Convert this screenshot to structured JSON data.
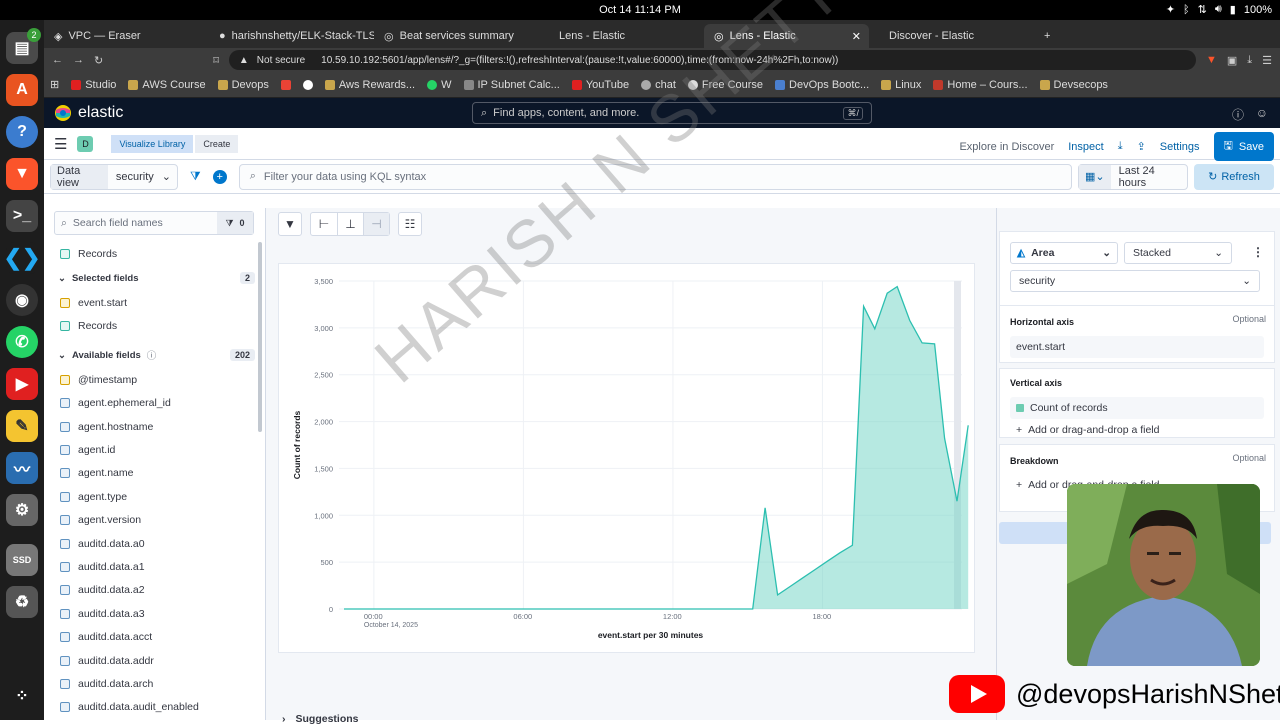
{
  "os": {
    "clock": "Oct 14  11:14 PM",
    "battery": "100%",
    "dock_badge": "2"
  },
  "browser": {
    "tabs": [
      {
        "label": "VPC — Eraser",
        "active": false
      },
      {
        "label": "harishnshetty/ELK-Stack-TLS",
        "active": false
      },
      {
        "label": "Beat services summary",
        "active": false
      },
      {
        "label": "Lens - Elastic",
        "active": false
      },
      {
        "label": "Lens - Elastic",
        "active": true
      },
      {
        "label": "Discover - Elastic",
        "active": false
      }
    ],
    "not_secure": "Not secure",
    "url": "10.59.10.192:5601/app/lens#/?_g=(filters:!(),refreshInterval:(pause:!t,value:60000),time:(from:now-24h%2Fh,to:now))",
    "bookmarks": [
      "Studio",
      "AWS Course",
      "Devops",
      "Aws Rewards...",
      "W",
      "IP Subnet Calc...",
      "YouTube",
      "chat",
      "Free Course",
      "DevOps Bootc...",
      "Linux",
      "Home – Cours...",
      "Devsecops"
    ]
  },
  "kibana": {
    "brand": "elastic",
    "search_placeholder": "Find apps, content, and more.",
    "search_shortcut": "⌘/",
    "space_letter": "D",
    "breadcrumbs": [
      "Visualize Library",
      "Create"
    ],
    "actions": {
      "explore": "Explore in Discover",
      "inspect": "Inspect",
      "settings": "Settings",
      "save": "Save"
    },
    "data_view_label": "Data view",
    "data_view_value": "security",
    "kql_placeholder": "Filter your data using KQL syntax",
    "time_range": "Last 24 hours",
    "refresh": "Refresh"
  },
  "field_list": {
    "search_placeholder": "Search field names",
    "filter_count": "0",
    "records_top": "Records",
    "selected_label": "Selected fields",
    "selected_count": "2",
    "selected": [
      {
        "name": "event.start",
        "type": "d"
      },
      {
        "name": "Records",
        "type": "n"
      }
    ],
    "available_label": "Available fields",
    "available_count": "202",
    "available": [
      {
        "name": "@timestamp",
        "type": "d"
      },
      {
        "name": "agent.ephemeral_id",
        "type": "k"
      },
      {
        "name": "agent.hostname",
        "type": "k"
      },
      {
        "name": "agent.id",
        "type": "k"
      },
      {
        "name": "agent.name",
        "type": "k"
      },
      {
        "name": "agent.type",
        "type": "k"
      },
      {
        "name": "agent.version",
        "type": "k"
      },
      {
        "name": "auditd.data.a0",
        "type": "k"
      },
      {
        "name": "auditd.data.a1",
        "type": "k"
      },
      {
        "name": "auditd.data.a2",
        "type": "k"
      },
      {
        "name": "auditd.data.a3",
        "type": "k"
      },
      {
        "name": "auditd.data.acct",
        "type": "k"
      },
      {
        "name": "auditd.data.addr",
        "type": "k"
      },
      {
        "name": "auditd.data.arch",
        "type": "k"
      },
      {
        "name": "auditd.data.audit_enabled",
        "type": "k"
      }
    ]
  },
  "chart_data": {
    "type": "area",
    "xlabel": "event.start per 30 minutes",
    "ylabel": "Count of records",
    "ylim": [
      0,
      3500
    ],
    "yticks": [
      0,
      500,
      1000,
      1500,
      2000,
      2500,
      3000,
      3500
    ],
    "xticks": [
      {
        "hour": 0,
        "label": "00:00",
        "sublabel": "October 14, 2025"
      },
      {
        "hour": 6,
        "label": "06:00"
      },
      {
        "hour": 12,
        "label": "12:00"
      },
      {
        "hour": 18,
        "label": "18:00"
      }
    ],
    "xlim": [
      -1.4,
      23.6
    ],
    "color": "#54b399",
    "series": [
      {
        "points": [
          [
            -1.2,
            0
          ],
          [
            0,
            0
          ],
          [
            3,
            0
          ],
          [
            6,
            0
          ],
          [
            9,
            0
          ],
          [
            12,
            0
          ],
          [
            15.2,
            0
          ],
          [
            15.7,
            1080
          ],
          [
            16.2,
            150
          ],
          [
            16.7,
            240
          ],
          [
            17.2,
            330
          ],
          [
            17.7,
            420
          ],
          [
            18.2,
            510
          ],
          [
            18.7,
            600
          ],
          [
            19.2,
            680
          ],
          [
            19.65,
            3230
          ],
          [
            20.1,
            2990
          ],
          [
            20.6,
            3370
          ],
          [
            21.0,
            3440
          ],
          [
            21.5,
            3080
          ],
          [
            22.0,
            2840
          ],
          [
            22.5,
            2830
          ],
          [
            22.9,
            1820
          ],
          [
            23.4,
            1150
          ],
          [
            23.85,
            1960
          ]
        ]
      }
    ]
  },
  "suggestions": "Suggestions",
  "config": {
    "chart_type": "Area",
    "stacking": "Stacked",
    "layer_data_view": "security",
    "horizontal_axis": "Horizontal axis",
    "horizontal_field": "event.start",
    "vertical_axis": "Vertical axis",
    "vertical_field": "Count of records",
    "add_field": "Add or drag-and-drop a field",
    "breakdown": "Breakdown",
    "optional": "Optional"
  },
  "watermark": "HARISH N SHETTY",
  "overlay_handle": "@devopsHarishNShetty"
}
